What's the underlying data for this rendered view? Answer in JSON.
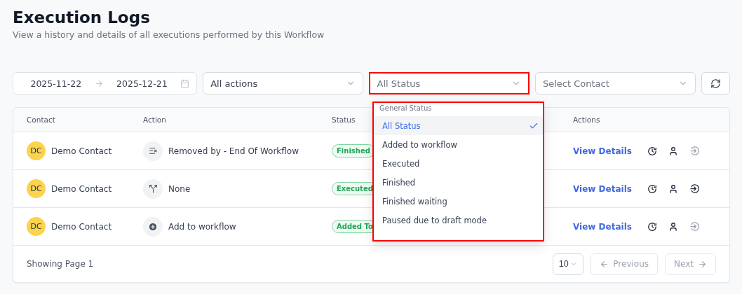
{
  "page": {
    "title": "Execution Logs",
    "subtitle": "View a history and details of all executions performed by this Workflow"
  },
  "filters": {
    "date_from": "2025-11-22",
    "date_to": "2025-12-21",
    "action": "All actions",
    "status": "All Status",
    "contact_placeholder": "Select Contact"
  },
  "table": {
    "columns": [
      "Contact",
      "Action",
      "Status",
      "Actions"
    ],
    "rows": [
      {
        "initials": "DC",
        "contact": "Demo Contact",
        "kind": "remove",
        "action": "Removed by - End Of Workflow",
        "status": "Finished",
        "link": "View Details",
        "enter_disabled": true
      },
      {
        "initials": "DC",
        "contact": "Demo Contact",
        "kind": "split",
        "action": "None",
        "status": "Executed",
        "link": "View Details",
        "enter_disabled": false
      },
      {
        "initials": "DC",
        "contact": "Demo Contact",
        "kind": "add",
        "action": "Add to workflow",
        "status": "Added To",
        "link": "View Details",
        "enter_disabled": true
      }
    ]
  },
  "footer": {
    "page_info": "Showing Page 1",
    "page_size": "10",
    "previous": {
      "label": "Previous",
      "disabled": true
    },
    "next": {
      "label": "Next",
      "disabled": true
    }
  },
  "status_menu": {
    "group": "General Status",
    "items": [
      {
        "label": "All Status",
        "selected": true
      },
      {
        "label": "Added to workflow",
        "selected": false
      },
      {
        "label": "Executed",
        "selected": false
      },
      {
        "label": "Finished",
        "selected": false
      },
      {
        "label": "Finished waiting",
        "selected": false
      },
      {
        "label": "Paused due to draft mode",
        "selected": false
      }
    ]
  }
}
